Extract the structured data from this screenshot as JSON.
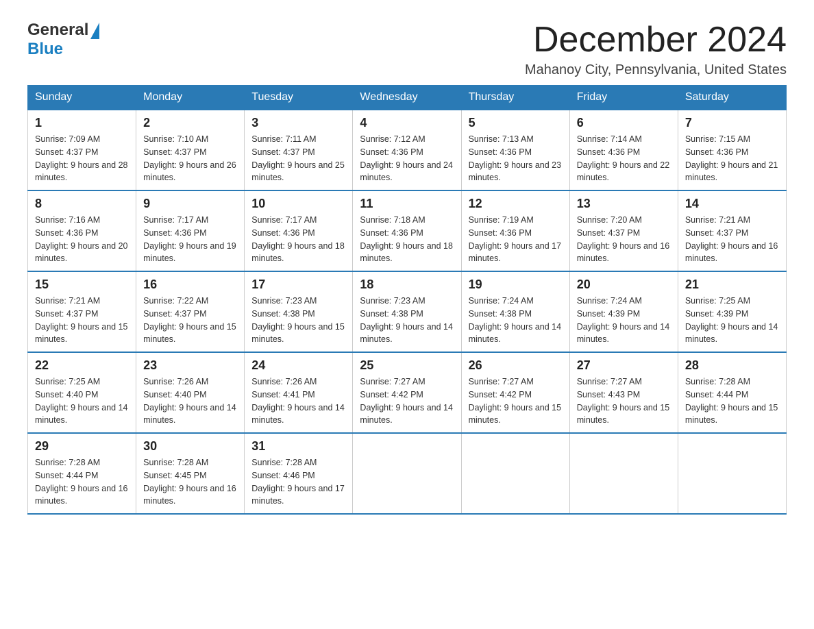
{
  "logo": {
    "general": "General",
    "blue": "Blue"
  },
  "title": {
    "month_year": "December 2024",
    "location": "Mahanoy City, Pennsylvania, United States"
  },
  "days_of_week": [
    "Sunday",
    "Monday",
    "Tuesday",
    "Wednesday",
    "Thursday",
    "Friday",
    "Saturday"
  ],
  "weeks": [
    [
      {
        "day": "1",
        "sunrise": "7:09 AM",
        "sunset": "4:37 PM",
        "daylight": "9 hours and 28 minutes."
      },
      {
        "day": "2",
        "sunrise": "7:10 AM",
        "sunset": "4:37 PM",
        "daylight": "9 hours and 26 minutes."
      },
      {
        "day": "3",
        "sunrise": "7:11 AM",
        "sunset": "4:37 PM",
        "daylight": "9 hours and 25 minutes."
      },
      {
        "day": "4",
        "sunrise": "7:12 AM",
        "sunset": "4:36 PM",
        "daylight": "9 hours and 24 minutes."
      },
      {
        "day": "5",
        "sunrise": "7:13 AM",
        "sunset": "4:36 PM",
        "daylight": "9 hours and 23 minutes."
      },
      {
        "day": "6",
        "sunrise": "7:14 AM",
        "sunset": "4:36 PM",
        "daylight": "9 hours and 22 minutes."
      },
      {
        "day": "7",
        "sunrise": "7:15 AM",
        "sunset": "4:36 PM",
        "daylight": "9 hours and 21 minutes."
      }
    ],
    [
      {
        "day": "8",
        "sunrise": "7:16 AM",
        "sunset": "4:36 PM",
        "daylight": "9 hours and 20 minutes."
      },
      {
        "day": "9",
        "sunrise": "7:17 AM",
        "sunset": "4:36 PM",
        "daylight": "9 hours and 19 minutes."
      },
      {
        "day": "10",
        "sunrise": "7:17 AM",
        "sunset": "4:36 PM",
        "daylight": "9 hours and 18 minutes."
      },
      {
        "day": "11",
        "sunrise": "7:18 AM",
        "sunset": "4:36 PM",
        "daylight": "9 hours and 18 minutes."
      },
      {
        "day": "12",
        "sunrise": "7:19 AM",
        "sunset": "4:36 PM",
        "daylight": "9 hours and 17 minutes."
      },
      {
        "day": "13",
        "sunrise": "7:20 AM",
        "sunset": "4:37 PM",
        "daylight": "9 hours and 16 minutes."
      },
      {
        "day": "14",
        "sunrise": "7:21 AM",
        "sunset": "4:37 PM",
        "daylight": "9 hours and 16 minutes."
      }
    ],
    [
      {
        "day": "15",
        "sunrise": "7:21 AM",
        "sunset": "4:37 PM",
        "daylight": "9 hours and 15 minutes."
      },
      {
        "day": "16",
        "sunrise": "7:22 AM",
        "sunset": "4:37 PM",
        "daylight": "9 hours and 15 minutes."
      },
      {
        "day": "17",
        "sunrise": "7:23 AM",
        "sunset": "4:38 PM",
        "daylight": "9 hours and 15 minutes."
      },
      {
        "day": "18",
        "sunrise": "7:23 AM",
        "sunset": "4:38 PM",
        "daylight": "9 hours and 14 minutes."
      },
      {
        "day": "19",
        "sunrise": "7:24 AM",
        "sunset": "4:38 PM",
        "daylight": "9 hours and 14 minutes."
      },
      {
        "day": "20",
        "sunrise": "7:24 AM",
        "sunset": "4:39 PM",
        "daylight": "9 hours and 14 minutes."
      },
      {
        "day": "21",
        "sunrise": "7:25 AM",
        "sunset": "4:39 PM",
        "daylight": "9 hours and 14 minutes."
      }
    ],
    [
      {
        "day": "22",
        "sunrise": "7:25 AM",
        "sunset": "4:40 PM",
        "daylight": "9 hours and 14 minutes."
      },
      {
        "day": "23",
        "sunrise": "7:26 AM",
        "sunset": "4:40 PM",
        "daylight": "9 hours and 14 minutes."
      },
      {
        "day": "24",
        "sunrise": "7:26 AM",
        "sunset": "4:41 PM",
        "daylight": "9 hours and 14 minutes."
      },
      {
        "day": "25",
        "sunrise": "7:27 AM",
        "sunset": "4:42 PM",
        "daylight": "9 hours and 14 minutes."
      },
      {
        "day": "26",
        "sunrise": "7:27 AM",
        "sunset": "4:42 PM",
        "daylight": "9 hours and 15 minutes."
      },
      {
        "day": "27",
        "sunrise": "7:27 AM",
        "sunset": "4:43 PM",
        "daylight": "9 hours and 15 minutes."
      },
      {
        "day": "28",
        "sunrise": "7:28 AM",
        "sunset": "4:44 PM",
        "daylight": "9 hours and 15 minutes."
      }
    ],
    [
      {
        "day": "29",
        "sunrise": "7:28 AM",
        "sunset": "4:44 PM",
        "daylight": "9 hours and 16 minutes."
      },
      {
        "day": "30",
        "sunrise": "7:28 AM",
        "sunset": "4:45 PM",
        "daylight": "9 hours and 16 minutes."
      },
      {
        "day": "31",
        "sunrise": "7:28 AM",
        "sunset": "4:46 PM",
        "daylight": "9 hours and 17 minutes."
      },
      null,
      null,
      null,
      null
    ]
  ]
}
